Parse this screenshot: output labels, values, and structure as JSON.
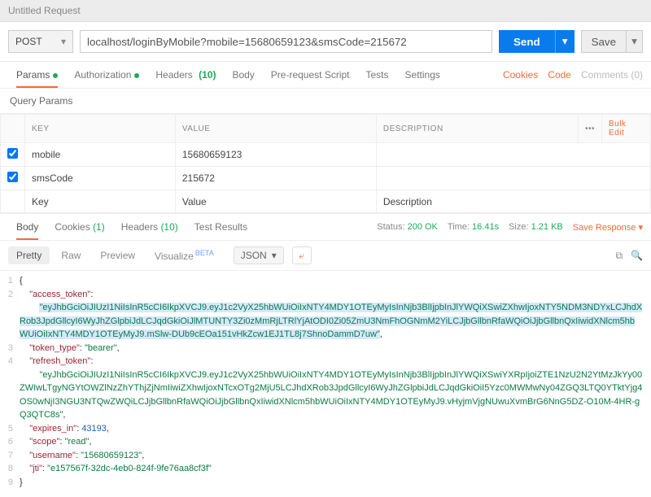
{
  "title": "Untitled Request",
  "method": "POST",
  "url": "localhost/loginByMobile?mobile=15680659123&smsCode=215672",
  "sendLabel": "Send",
  "saveLabel": "Save",
  "tabs": {
    "params": "Params",
    "auth": "Authorization",
    "headers": "Headers",
    "headersCount": "(10)",
    "body": "Body",
    "prereq": "Pre-request Script",
    "tests": "Tests",
    "settings": "Settings"
  },
  "rightLinks": {
    "cookies": "Cookies",
    "code": "Code",
    "comments": "Comments (0)"
  },
  "queryTitle": "Query Params",
  "cols": {
    "key": "KEY",
    "value": "VALUE",
    "desc": "DESCRIPTION"
  },
  "bulk": "Bulk Edit",
  "rows": [
    {
      "checked": true,
      "key": "mobile",
      "value": "15680659123"
    },
    {
      "checked": true,
      "key": "smsCode",
      "value": "215672"
    }
  ],
  "ph": {
    "key": "Key",
    "value": "Value",
    "desc": "Description"
  },
  "respTabs": {
    "body": "Body",
    "cookies": "Cookies",
    "cookiesCount": "(1)",
    "headers": "Headers",
    "headersCount": "(10)",
    "tests": "Test Results"
  },
  "status": {
    "k": "Status:",
    "v": "200 OK"
  },
  "time": {
    "k": "Time:",
    "v": "16.41s"
  },
  "size": {
    "k": "Size:",
    "v": "1.21 KB"
  },
  "saveResp": "Save Response",
  "viewer": {
    "pretty": "Pretty",
    "raw": "Raw",
    "preview": "Preview",
    "visualize": "Visualize",
    "json": "JSON"
  },
  "json": {
    "access_token": "eyJhbGciOiJIUzI1NiIsInR5cCI6IkpXVCJ9.eyJ1c2VyX25hbWUiOiIxNTY4MDY1OTEyMyIsInNjb3BlIjpbInJlYWQiXSwiZXhwIjoxNTY5NDM3NDYxLCJhdXRob3JpdGllcyI6WyJhZGlpbiJdLCJqdGkiOiJlMTUNTY3Zi0zMmRjLTRlYjAtODI0Zi05ZmU3NmFhOGNmM2YiLCJjbGllbnRfaWQiOiJjbGllbnQxIiwidXNlcm5hbWUiOiIxNTY4MDY1OTEyMyJ9.mSlw-DUb9cEOa151vHkZcw1EJ1TL8j7ShnoDammD7uw",
    "token_type": "bearer",
    "refresh_token": "eyJhbGciOiJIUzI1NiIsInR5cCI6IkpXVCJ9.eyJ1c2VyX25hbWUiOiIxNTY4MDY1OTEyMyIsInNjb3BlIjpbInJlYWQiXSwiYXRpIjoiZTE1NzU2N2YtMzJkYy00ZWIwLTgyNGYtOWZlNzZhYThjZjNmIiwiZXhwIjoxNTcxOTg2MjU5LCJhdXRob3JpdGllcyI6WyJhZGlpbiJdLCJqdGkiOiI5Yzc0MWMwNy04ZGQ3LTQ0YTktYjg4OS0wNjI3NGU3NTQwZWQiLCJjbGllbnRfaWQiOiJjbGllbnQxIiwidXNlcm5hbWUiOiIxNTY4MDY1OTEyMyJ9.vHyjmVjgNUwuXvmBrG6NnG5DZ-O10M-4HR-gQ3QTC8s",
    "expires_in": 43193,
    "scope": "read",
    "username": "15680659123",
    "jti": "e157567f-32dc-4eb0-824f-9fe76aa8cf3f"
  }
}
